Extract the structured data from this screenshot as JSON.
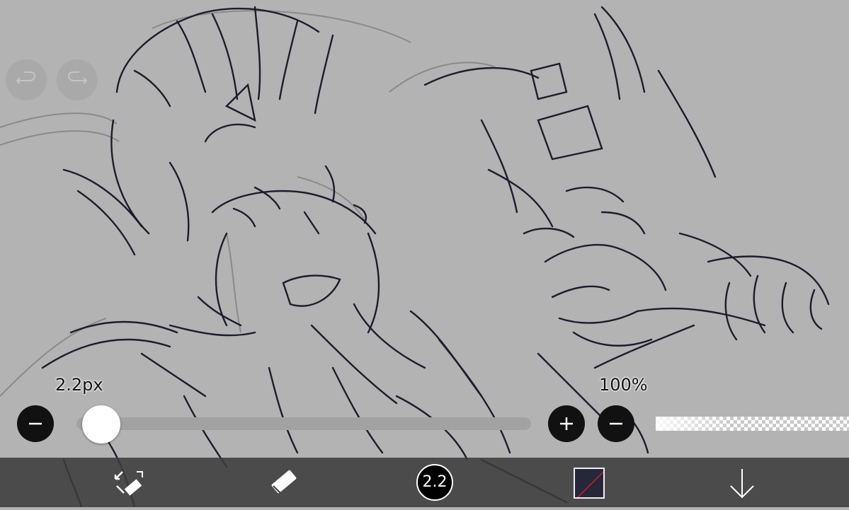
{
  "app": {
    "undo": {
      "icon": "undo-icon"
    },
    "redo": {
      "icon": "redo-icon"
    }
  },
  "brush_size": {
    "label": "2.2px",
    "value_fraction": 0.02,
    "minus_icon": "minus-icon"
  },
  "opacity": {
    "label": "100%",
    "value_fraction": 1.0,
    "plus_icon": "plus-icon",
    "minus_icon": "minus-icon"
  },
  "toolbar": {
    "transform_icon": "transform-icon",
    "eraser_icon": "eraser-icon",
    "brush_badge": "2.2",
    "color_swatch": "#27273a",
    "download_icon": "arrow-down-icon"
  },
  "colors": {
    "canvas_bg": "#b3b3b3",
    "line_dark": "#1c1d2b",
    "line_light": "#8a8a8a",
    "toolbar_bg": "#3c3c3c"
  }
}
